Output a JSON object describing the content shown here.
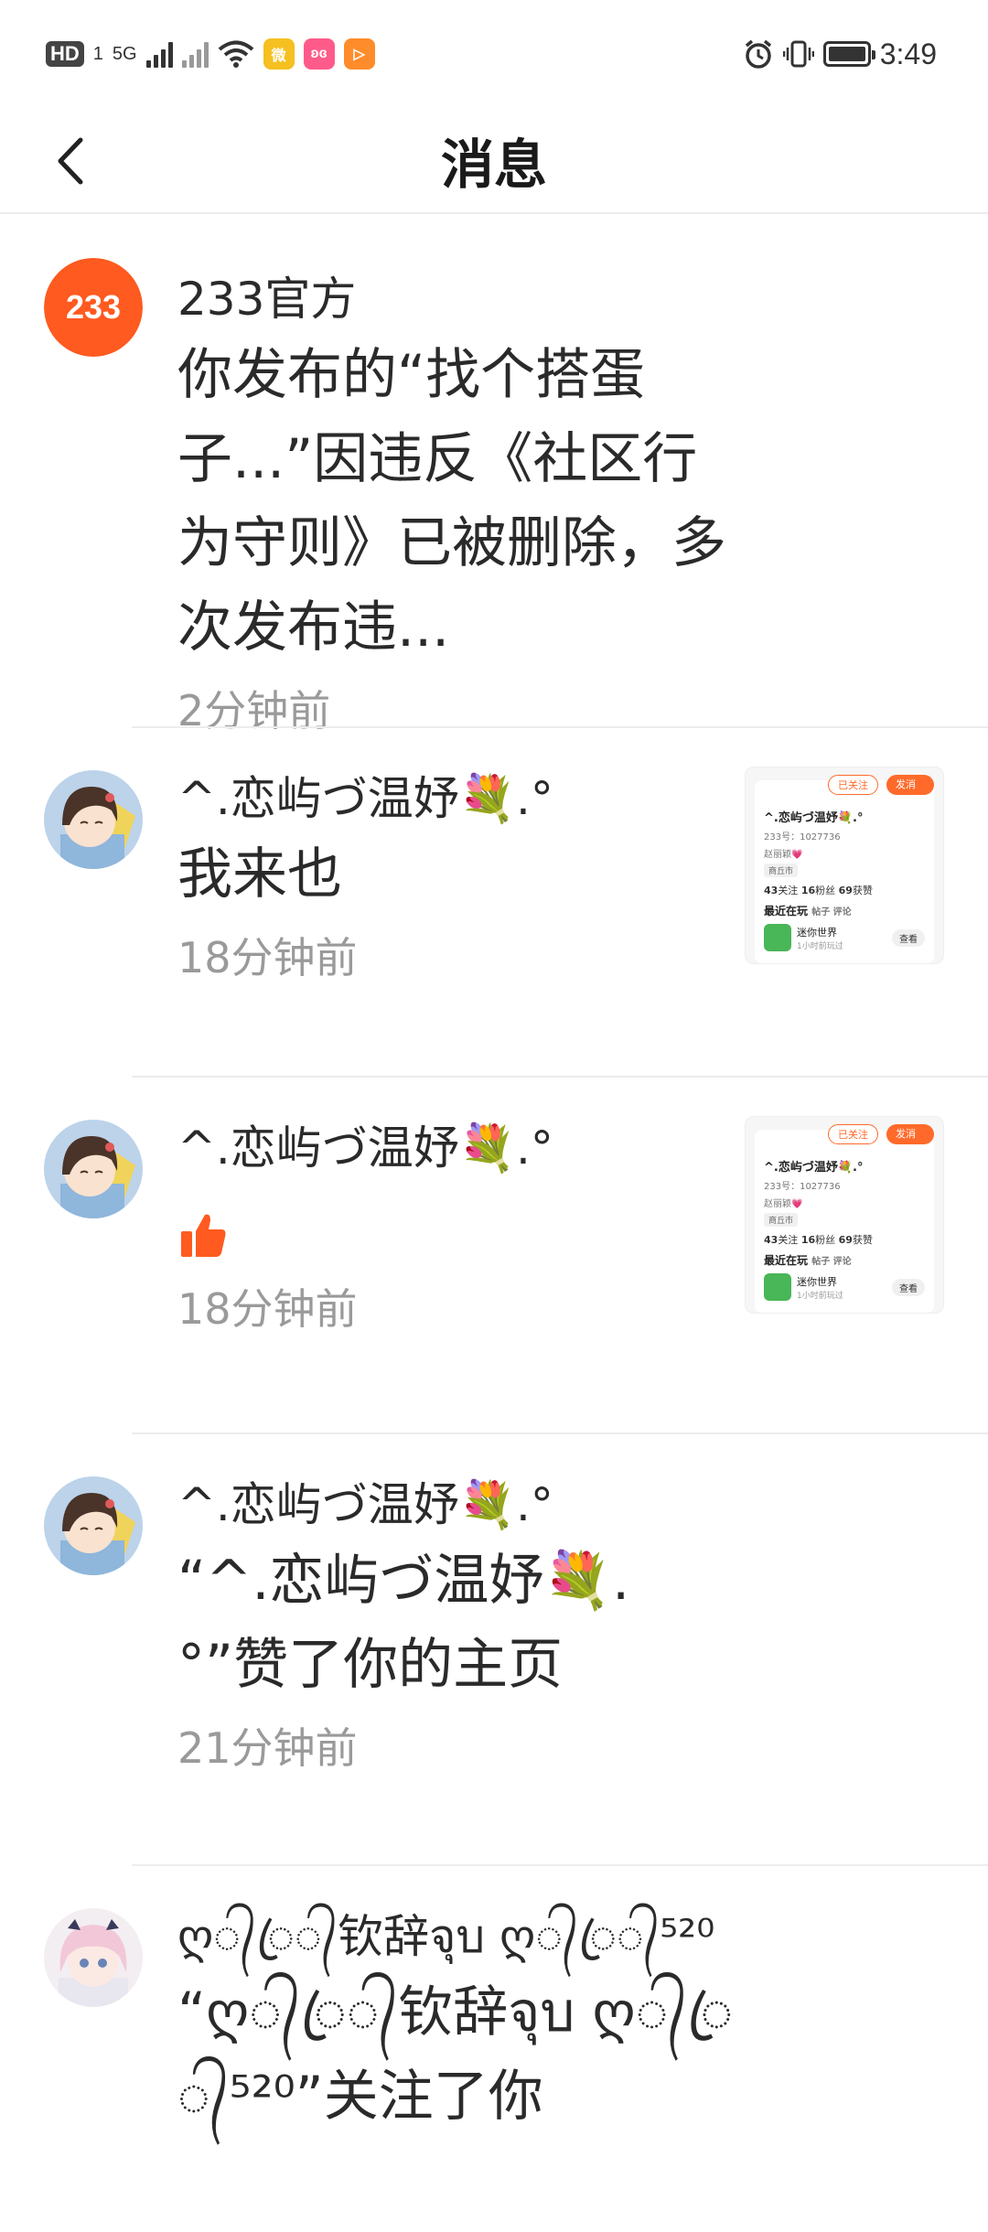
{
  "status_bar": {
    "hd": "HD",
    "sim": "1",
    "network": "5G",
    "time": "3:49",
    "app_icons": [
      {
        "name": "weibo-icon",
        "color": "#f5c020",
        "glyph": "微"
      },
      {
        "name": "pink-app-icon",
        "color": "#ff5b8a",
        "glyph": "ʚɞ"
      },
      {
        "name": "play-app-icon",
        "color": "#ff8c2a",
        "glyph": "▷"
      }
    ]
  },
  "header": {
    "title": "消息"
  },
  "messages": [
    {
      "sender": "233官方",
      "avatar_text": "233",
      "text": "你发布的“找个搭蛋子...”因违反《社区行为守则》已被删除，多次发布违...",
      "time": "2分钟前"
    },
    {
      "sender": "^.恋屿づ温妤💐.°",
      "text": "我来也",
      "time": "18分钟前",
      "thumbnail": {
        "btn_followed": "已关注",
        "btn_message": "发消息",
        "name": "^.恋屿づ温妤💐.°",
        "id": "233号：1027736",
        "tag": "赵丽颖💗",
        "city": "商丘市",
        "following": "43",
        "following_label": "关注",
        "fans": "16",
        "fans_label": "粉丝",
        "likes": "69",
        "likes_label": "获赞",
        "recent": "最近在玩",
        "recent_sub": "帖子  评论",
        "game": "迷你世界",
        "game_sub": "1小时前玩过",
        "view": "查看"
      }
    },
    {
      "sender": "^.恋屿づ温妤💐.°",
      "text": "",
      "time": "18分钟前",
      "thumbs_up_icon": "thumbs-up-icon",
      "thumbnail": {
        "btn_followed": "已关注",
        "btn_message": "发消息",
        "name": "^.恋屿づ温妤💐.°",
        "id": "233号：1027736",
        "tag": "赵丽颖💗",
        "city": "商丘市",
        "following": "43",
        "following_label": "关注",
        "fans": "16",
        "fans_label": "粉丝",
        "likes": "69",
        "likes_label": "获赞",
        "recent": "最近在玩",
        "recent_sub": "帖子  评论",
        "game": "迷你世界",
        "game_sub": "1小时前玩过",
        "view": "查看"
      }
    },
    {
      "sender": "^.恋屿づ温妤💐.°",
      "text": "“^.恋屿づ温妤💐.°”赞了你的主页",
      "time": "21分钟前"
    },
    {
      "sender": "ღ᭄ꦿ᭄钦辞จุบ ღ᭄ꦿ᭄⁵²⁰",
      "text": "“ღ᭄ꦿ᭄钦辞จุบ ღ᭄ꦿ᭄⁵²⁰”关注了你",
      "time": ""
    }
  ],
  "colors": {
    "accent": "#ff6a2a",
    "time_gray": "#9a9a9a",
    "divider": "#ececec"
  }
}
